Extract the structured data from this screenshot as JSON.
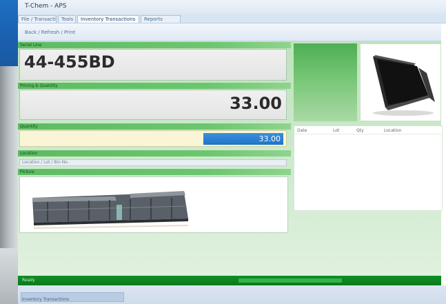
{
  "window": {
    "title": "T-Chem ‑ APS"
  },
  "tabs": [
    {
      "label": "File / Transactions",
      "active": false
    },
    {
      "label": "Tools",
      "active": false
    },
    {
      "label": "Inventory Transactions",
      "active": true
    },
    {
      "label": "Reports",
      "active": false
    }
  ],
  "toolbar": {
    "caption": "Back / Refresh / Print"
  },
  "form": {
    "serial": {
      "label": "Serial Line",
      "value": "44-455BD"
    },
    "amount": {
      "label": "Pricing & Quantity",
      "value": "33.00"
    },
    "quantity": {
      "label": "Quantity",
      "selected": "33.00"
    },
    "location": {
      "label": "Location",
      "value": "Location / Lot / Bin No."
    },
    "picture": {
      "label": "Picture"
    }
  },
  "grid": {
    "columns": [
      "Date",
      "Lot",
      "Qty",
      "Location"
    ]
  },
  "status": {
    "text": "Ready"
  },
  "footer": {
    "text": "Inventory Transactions"
  },
  "colors": {
    "accent_green": "#4fae55",
    "status_green": "#0f8f24",
    "selection_blue": "#1f74c7",
    "frame_blue": "#1f6fc0"
  },
  "icons": {
    "thumbnail": "black-binder-folder-icon"
  }
}
